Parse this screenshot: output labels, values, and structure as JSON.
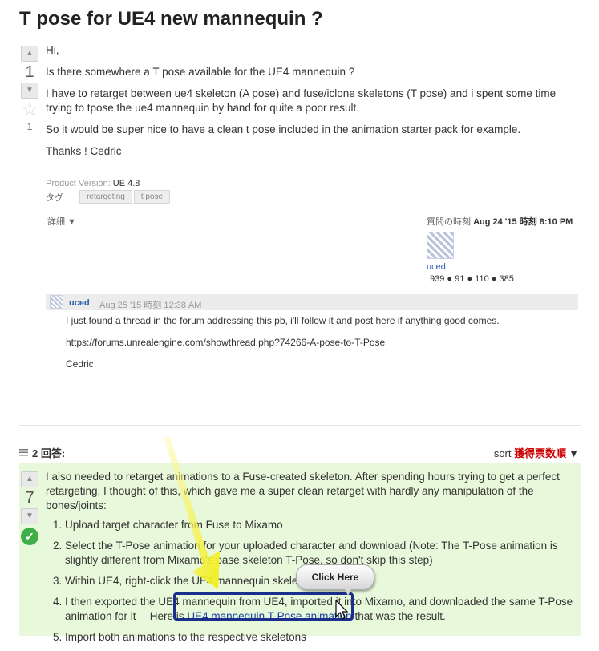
{
  "question": {
    "title": "T pose for UE4 new mannequin ?",
    "votes": "1",
    "favorites": "1",
    "body": [
      "Hi,",
      "Is there somewhere a T pose available for the UE4 mannequin ?",
      "I have to retarget between ue4 skeleton (A pose) and fuse/iclone skeletons (T pose) and i spent some time trying to tpose the ue4 mannequin by hand for quite a poor result.",
      "So it would be super nice to have a clean t pose included in the animation starter pack for example.",
      "Thanks ! Cedric"
    ],
    "product_version_label": "Product Version:",
    "product_version": "UE 4.8",
    "tags_label": "タグ　:",
    "tags": [
      "retargeting",
      "t pose"
    ],
    "details_label": "詳細 ▼",
    "asked_label": "質問の時刻",
    "asked_time": "Aug 24 '15 時刻 8:10 PM",
    "user": {
      "name": "uced",
      "rep": "939",
      "gold": "91",
      "silver": "110",
      "bronze": "385"
    }
  },
  "comment": {
    "user": "uced",
    "date": "Aug 25 '15 時刻 12:38 AM",
    "lines": [
      "I just found a thread in the forum addressing this pb, i'll follow it and post here if anything good comes.",
      "https://forums.unrealengine.com/showthread.php?74266-A-pose-to-T-Pose",
      "Cedric"
    ]
  },
  "answers": {
    "count_label": "2 回答:",
    "sort_label": "sort",
    "sort_value": "獲得票数順",
    "first": {
      "votes": "7",
      "intro": "I also needed to retarget animations to a Fuse-created skeleton. After spending hours trying to get a perfect retargeting, I thought of this, which gave me a super clean retarget with hardly any manipulation of the bones/joints:",
      "steps": [
        "Upload target character from Fuse to Mixamo",
        "Select the T-Pose animation for your uploaded character and download (Note: The T-Pose animation is slightly different from Mixamo's base skeleton T-Pose, so don't skip this step)",
        "Within UE4, right-click the UE4 mannequin skeleton and export",
        "I then exported the UE4 mannequin from UE4, imported it into Mixamo, and downloaded the same T-Pose animation for it —Here is ",
        "Import both animations to the respective skeletons"
      ],
      "step4_link": "UE4 mannequin T-Pose animation",
      "step4_after": " that was the result."
    }
  },
  "overlay": {
    "callout_label": "Click Here"
  }
}
